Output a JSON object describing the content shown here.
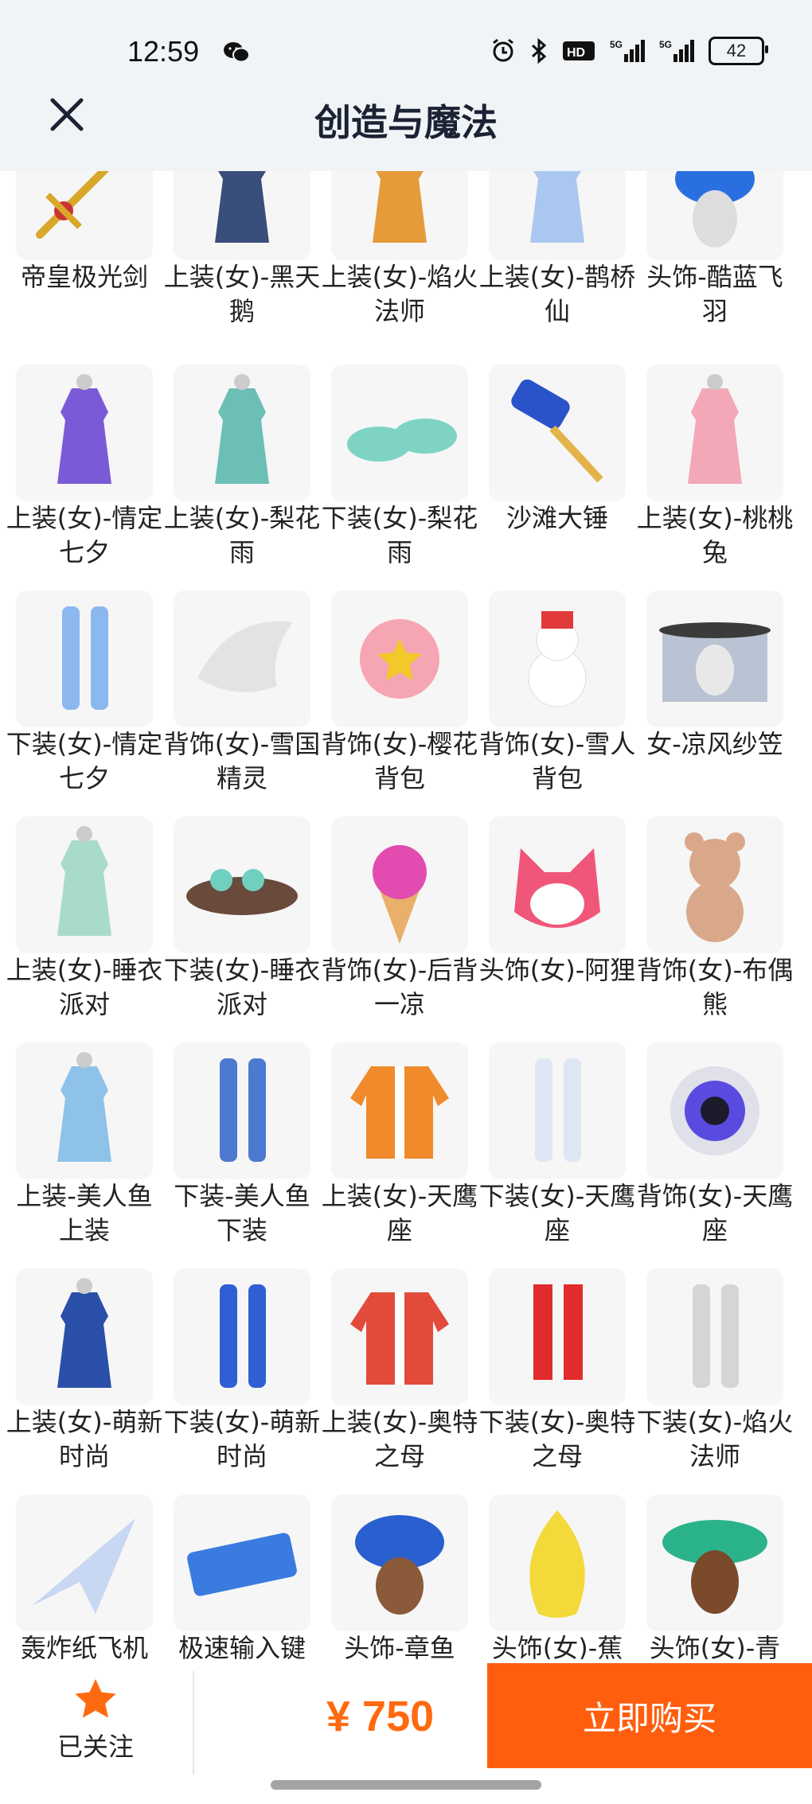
{
  "status": {
    "time": "12:59",
    "battery": "42"
  },
  "header": {
    "title": "创造与魔法"
  },
  "items": [
    {
      "label": "帝皇极光剑",
      "icon": "sword-icon",
      "color": "#d9a72a"
    },
    {
      "label": "上装(女)-黑天鹅",
      "icon": "dress-icon",
      "color": "#3a4e7b"
    },
    {
      "label": "上装(女)-焰火法师",
      "icon": "dress-icon",
      "color": "#e59b3a"
    },
    {
      "label": "上装(女)-鹊桥仙",
      "icon": "dress-icon",
      "color": "#aac8ef"
    },
    {
      "label": "头饰-酷蓝飞羽",
      "icon": "cap-icon",
      "color": "#2a6fe0"
    },
    {
      "label": "上装(女)-情定七夕",
      "icon": "dress-icon",
      "color": "#7b5ad7"
    },
    {
      "label": "上装(女)-梨花雨",
      "icon": "dress-icon",
      "color": "#6bbfb5"
    },
    {
      "label": "下装(女)-梨花雨",
      "icon": "shoes-icon",
      "color": "#7fd3c5"
    },
    {
      "label": "沙滩大锤",
      "icon": "hammer-icon",
      "color": "#2a52c9"
    },
    {
      "label": "上装(女)-桃桃兔",
      "icon": "dress-icon",
      "color": "#f3a8b8"
    },
    {
      "label": "下装(女)-情定七夕",
      "icon": "legs-icon",
      "color": "#8bb8ef"
    },
    {
      "label": "背饰(女)-雪国精灵",
      "icon": "wings-icon",
      "color": "#e3e3e3"
    },
    {
      "label": "背饰(女)-樱花背包",
      "icon": "flower-icon",
      "color": "#f6a5b3"
    },
    {
      "label": "背饰(女)-雪人背包",
      "icon": "snowman-icon",
      "color": "#e23a3a"
    },
    {
      "label": "女-凉风纱笠",
      "icon": "hat-icon",
      "color": "#7d8fb0"
    },
    {
      "label": "上装(女)-睡衣派对",
      "icon": "dress-icon",
      "color": "#a8dcc8"
    },
    {
      "label": "下装(女)-睡衣派对",
      "icon": "slippers-icon",
      "color": "#6a4a3a"
    },
    {
      "label": "背饰(女)-后背一凉",
      "icon": "icecream-icon",
      "color": "#e24bb0"
    },
    {
      "label": "头饰(女)-阿狸",
      "icon": "fox-icon",
      "color": "#f0567a"
    },
    {
      "label": "背饰(女)-布偶熊",
      "icon": "bear-icon",
      "color": "#d9a88a"
    },
    {
      "label": "上装-美人鱼上装",
      "icon": "dress-icon",
      "color": "#8fc2e8"
    },
    {
      "label": "下装-美人鱼下装",
      "icon": "legs-icon",
      "color": "#4b7ad0"
    },
    {
      "label": "上装(女)-天鹰座",
      "icon": "jacket-icon",
      "color": "#f08a2a"
    },
    {
      "label": "下装(女)-天鹰座",
      "icon": "legs-icon",
      "color": "#dfe6f3"
    },
    {
      "label": "背饰(女)-天鹰座",
      "icon": "orb-icon",
      "color": "#5a4be0"
    },
    {
      "label": "上装(女)-萌新时尚",
      "icon": "dress-icon",
      "color": "#2a4fa8"
    },
    {
      "label": "下装(女)-萌新时尚",
      "icon": "legs-icon",
      "color": "#2f5fd2"
    },
    {
      "label": "上装(女)-奥特之母",
      "icon": "jacket-icon",
      "color": "#e24a3a"
    },
    {
      "label": "下装(女)-奥特之母",
      "icon": "boots-icon",
      "color": "#e02c2c"
    },
    {
      "label": "下装(女)-焰火法师",
      "icon": "legs-icon",
      "color": "#d5d5d5"
    },
    {
      "label": "轰炸纸飞机",
      "icon": "paperplane-icon",
      "color": "#c8d8f3"
    },
    {
      "label": "极速输入键",
      "icon": "keyboard-icon",
      "color": "#3a7be0"
    },
    {
      "label": "头饰-章鱼",
      "icon": "octopus-icon",
      "color": "#2a5fd0"
    },
    {
      "label": "头饰(女)-蕉",
      "icon": "banana-icon",
      "color": "#f3d93a"
    },
    {
      "label": "头饰(女)-青",
      "icon": "leafhat-icon",
      "color": "#2ab38a"
    }
  ],
  "bottom": {
    "follow_label": "已关注",
    "price": "¥ 750",
    "buy_label": "立即购买"
  }
}
